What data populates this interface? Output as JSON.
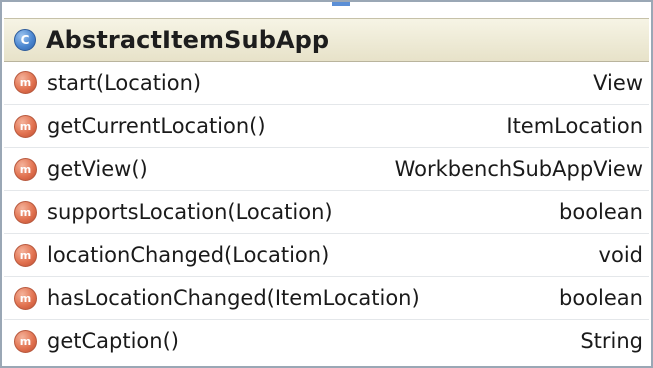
{
  "class": {
    "badge_letter": "C",
    "name": "AbstractItemSubApp"
  },
  "methods": [
    {
      "icon_letter": "m",
      "name": "start(Location)",
      "type": "View"
    },
    {
      "icon_letter": "m",
      "name": "getCurrentLocation()",
      "type": "ItemLocation"
    },
    {
      "icon_letter": "m",
      "name": "getView()",
      "type": "WorkbenchSubAppView"
    },
    {
      "icon_letter": "m",
      "name": "supportsLocation(Location)",
      "type": "boolean"
    },
    {
      "icon_letter": "m",
      "name": "locationChanged(Location)",
      "type": "void"
    },
    {
      "icon_letter": "m",
      "name": "hasLocationChanged(ItemLocation)",
      "type": "boolean"
    },
    {
      "icon_letter": "m",
      "name": "getCaption()",
      "type": "String"
    }
  ],
  "colors": {
    "class_badge": "#4c87d0",
    "method_icon": "#e27452",
    "header_bg": "#ece8d2",
    "border": "#9aa7b5"
  },
  "icons": {
    "class": "class-c-icon",
    "method": "method-m-icon"
  }
}
